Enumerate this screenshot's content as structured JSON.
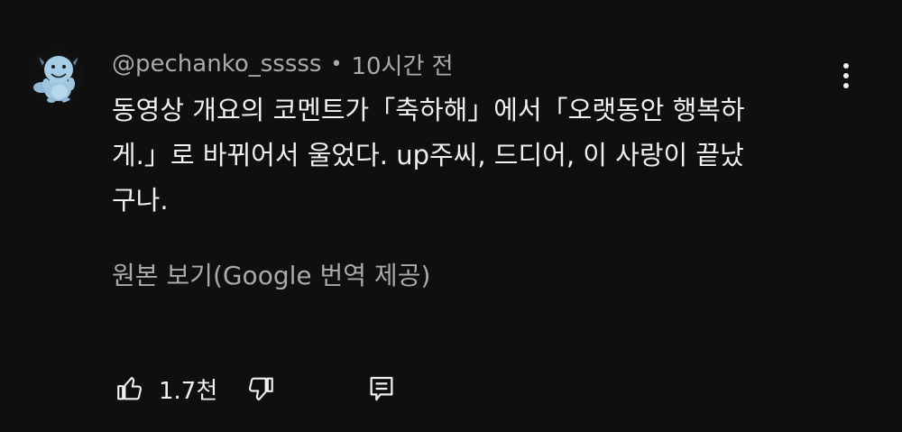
{
  "comment": {
    "author": "@pechanko_sssss",
    "separator": "•",
    "timestamp": "10시간 전",
    "text_lines": [
      "동영상 개요의 코멘트가「축하해」에서「오랫동안 행복하",
      "게.」로 바뀌어서 울었다. up주씨, 드디어, 이 사랑이 끝났",
      "구나."
    ],
    "translate_label": "원본 보기(Google 번역 제공)",
    "like_count": "1.7천"
  },
  "icons": {
    "avatar": "quagsire-avatar",
    "more": "more-vert-icon",
    "like": "thumb-up-icon",
    "dislike": "thumb-down-icon",
    "reply": "reply-comment-icon"
  },
  "colors": {
    "background": "#0f0f0f",
    "primary_text": "#f1f1f1",
    "secondary_text": "#aaaaaa",
    "avatar_body": "#9ec6e0"
  }
}
